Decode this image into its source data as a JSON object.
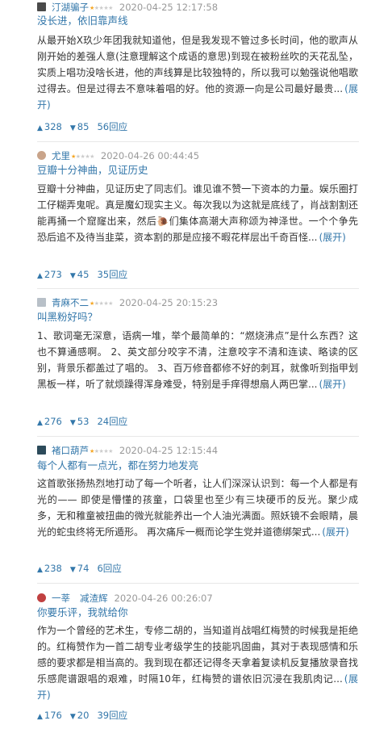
{
  "reviews": [
    {
      "username": "汀湖骗子",
      "stars_filled": 1,
      "stars_total": 5,
      "time": "2020-04-25 12:17:58",
      "title": "没长进，依旧靠声线",
      "body": "从最开始X玖少年团我就知道他，但是我发现不管过多长时间，他的歌声从刚开始的差强人意(注意理解这个成语的意思)到现在被粉丝吹的天花乱坠，实质上唱功没啥长进，他的声线算是比较独特的，所以我可以勉强说他唱歌过得去。但是过得去不意味着唱的好。他的资源一向是公司最好最贵...",
      "more": "(展开)",
      "upvotes": "328",
      "downvotes": "85",
      "replies": "56回应",
      "avatar_color": "#4a4a4a"
    },
    {
      "username": "尤里",
      "stars_filled": 1,
      "stars_total": 5,
      "time": "2020-04-26 00:44:45",
      "title": "豆瓣十分神曲，见证历史",
      "body": "豆瓣十分神曲，见证历史了同志们。谁见谁不赞一下资本的力量。娱乐圈打工仔糊弄鬼呢。真是魔幻现实主义。每次我以为这就是底线了，肖战割割还能再捅一个窟窿出来，然后🐌们集体高潮大声称颂为神泽世。一个个争先恐后追不及待当韭菜，资本割的那是应接不暇花样层出千奇百怪...",
      "more": "(展开)",
      "upvotes": "273",
      "downvotes": "45",
      "replies": "35回应",
      "avatar_color": "#c9a48a"
    },
    {
      "username": "青麻不二",
      "stars_filled": 1,
      "stars_total": 5,
      "time": "2020-04-25 20:15:23",
      "title": "叫黑粉好吗？",
      "body": "1、歌词毫无深意，语病一堆，举个最简单的：“燃烧沸点”是什么东西？这也不算通感啊。 2、英文部分咬字不清，注意咬字不清和连读、略读的区别，背景乐都盖过了唱的。 3、百万修音都修不好的刺耳，就像听到指甲划黑板一样，听了就烦躁得浑身难受，特别是手痒得想扇人两巴掌...",
      "more": "(展开)",
      "upvotes": "276",
      "downvotes": "53",
      "replies": "24回应",
      "avatar_color": "#b8c0c8"
    },
    {
      "username": "褚口葫芦",
      "stars_filled": 1,
      "stars_total": 5,
      "time": "2020-04-25 12:15:44",
      "title": "每个人都有一点光，都在努力地发亮",
      "body": "这首歌张扬热烈地打动了每一个听者，让人们深深认识到：每一个人都是有光的—— 即使是懵懂的孩童，口袋里也至少有三块硬币的反光。聚少成多，无和稚童被扭曲的微光就能养出一个人油光满面。照妖镜不会眼睛，晨光的蛇虫终将无所遁形。 再次痛斥一概而论学生党并道德绑架式...",
      "more": "(展开)",
      "upvotes": "238",
      "downvotes": "74",
      "replies": "6回应",
      "avatar_color": "#2c4a5a"
    },
    {
      "username": "一莘",
      "stars_filled": 0,
      "stars_total": 0,
      "time": "2020-04-26 00:26:07",
      "tag": "减渣辉",
      "title": "你要乐评，我就给你",
      "body": "作为一个曾经的艺术生，专修二胡的，当知道肖战唱红梅赞的时候我是拒绝的。红梅赞作为一首二胡专业考级学生的技能巩固曲，其对于表现感情和乐感的要求都是相当高的。我到现在都还记得冬天拿着复读机反复播放录音找乐感爬谱跟唱的艰难，时隔10年，红梅赞的谱依旧沉浸在我肌肉记...",
      "more": "(展开)",
      "upvotes": "176",
      "downvotes": "20",
      "replies": "39回应",
      "avatar_color": "#c04040"
    }
  ]
}
